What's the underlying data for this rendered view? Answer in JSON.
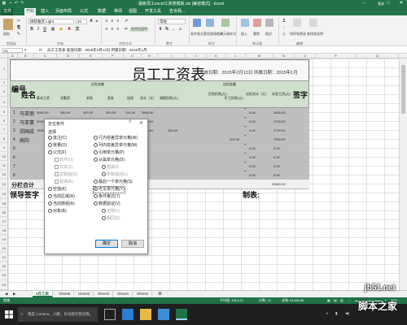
{
  "window": {
    "title": "最新员工excel工资表模板.xls [兼容模式] - Excel",
    "username": "登录"
  },
  "tabs": [
    "文件",
    "开始",
    "插入",
    "页面布局",
    "公式",
    "数据",
    "审阅",
    "视图",
    "开发工具",
    "告诉我..."
  ],
  "active_tab": "开始",
  "ribbon": {
    "paste_label": "粘贴",
    "clipboard_group": "剪贴板",
    "font_name": "微软雅黑 Light",
    "font_size": "20",
    "font_group": "字体",
    "align_group": "对齐方式",
    "number_format": "常规",
    "number_group": "数字",
    "style_items": [
      "条件格式",
      "套用表格格式",
      "单元格样式"
    ],
    "styles_group": "样式",
    "cells_items": [
      "插入",
      "删除",
      "格式"
    ],
    "cells_group": "单元格",
    "edit_items": [
      "排序和筛选",
      "查找和选择"
    ],
    "edit_group": "编辑",
    "cell_styles": [
      "常规",
      "差",
      "好",
      "适中"
    ],
    "merge_label": "合并后居中"
  },
  "formula_bar": {
    "name_box": "A1",
    "fx": "fx",
    "value": "员工工资表 发放日期：2015年2月12日 所属日期：2015年1月"
  },
  "columns": [
    "A",
    "B",
    "C",
    "D",
    "E",
    "F",
    "G",
    "H",
    "I",
    "J",
    "K",
    "L",
    "M",
    "N",
    "O",
    "P",
    "Q"
  ],
  "rows": [
    "1",
    "2",
    "3",
    "4",
    "5",
    "6",
    "7",
    "8",
    "9",
    "10",
    "11",
    "12",
    "13",
    "14",
    "15",
    "16",
    "17",
    "18",
    "19",
    "20",
    "21",
    "22",
    "23",
    "24",
    "25",
    "26"
  ],
  "sheet": {
    "title": "员工工资表",
    "subtitle": "发放日期：2015年2月12日  所属日期：2015年1月",
    "headers": {
      "no": "编号",
      "name": "姓名",
      "should_pay": "应发金额",
      "deduct": "应扣金额",
      "basic": "基本工资",
      "attend": "全勤奖",
      "subsidy": "补贴",
      "bonus": "奖金",
      "overtime": "加班",
      "total": "合计（元）",
      "leave": "请假扣款(元)",
      "late": "迟到扣款(元)",
      "absent": "旷工扣款(元)",
      "deduct_total": "应扣合计（元）",
      "real_pay": "实发工资(元)",
      "sign": "签字"
    },
    "employees": [
      {
        "no": "1",
        "name": "马亚丽",
        "basic": "3000.00",
        "attend": "150.00",
        "subsidy": "300.00",
        "bonus": "300.00",
        "overtime": "100.00",
        "total": "3850.00",
        "leave": "",
        "deduct_total": "0.00",
        "real": "3850.00"
      },
      {
        "no": "2",
        "name": "马亚寰",
        "basic": "2000.00",
        "attend": "150.00",
        "subsidy": "300.00",
        "bonus": "200.00",
        "overtime": "50.00",
        "total": "2700.00",
        "leave": "",
        "deduct_total": "0.00",
        "real": "2700.00"
      },
      {
        "no": "3",
        "name": "郑国成",
        "basic": "2500.00",
        "attend": "150.00",
        "subsidy": "300.00",
        "bonus": "100.00",
        "overtime": "",
        "total": "3050.00",
        "leave": "330.00",
        "deduct_total": "0.00",
        "real": "2720.00"
      },
      {
        "no": "4",
        "name": "高阳",
        "basic": "",
        "attend": "",
        "subsidy": "",
        "bonus": "",
        "overtime": "",
        "total": "",
        "leave": "",
        "deduct_total": "200.00",
        "real": "7900.00"
      },
      {
        "no": "5",
        "name": "",
        "basic": "",
        "attend": "",
        "subsidy": "",
        "bonus": "",
        "overtime": "",
        "total": "",
        "leave": "",
        "deduct_total": "0.00",
        "real": "0.00"
      },
      {
        "no": "6",
        "name": "",
        "basic": "",
        "attend": "",
        "subsidy": "",
        "bonus": "",
        "overtime": "",
        "total": "",
        "leave": "",
        "deduct_total": "0.00",
        "real": "0.00"
      },
      {
        "no": "7",
        "name": "",
        "basic": "",
        "attend": "",
        "subsidy": "",
        "bonus": "",
        "overtime": "",
        "total": "",
        "leave": "",
        "deduct_total": "0.00",
        "real": "0.00"
      },
      {
        "no": "8",
        "name": "",
        "basic": "",
        "attend": "",
        "subsidy": "",
        "bonus": "",
        "overtime": "",
        "total": "",
        "leave": "",
        "deduct_total": "0.00",
        "real": "0.00"
      }
    ],
    "sum_label": "分栏合计",
    "sum_total": "20820.00",
    "footer_left": "领导签字",
    "footer_right": "制表:"
  },
  "dialog": {
    "title": "定位条件",
    "help": "?",
    "close": "✕",
    "group_label": "选择",
    "left_options": [
      {
        "label": "批注(C)",
        "type": "radio",
        "checked": false,
        "disabled": false
      },
      {
        "label": "常量(O)",
        "type": "radio",
        "checked": false,
        "disabled": false
      },
      {
        "label": "公式(F)",
        "type": "radio",
        "checked": false,
        "disabled": false
      },
      {
        "label": "数字(U)",
        "type": "check",
        "checked": false,
        "disabled": true
      },
      {
        "label": "文本(X)",
        "type": "check",
        "checked": false,
        "disabled": true
      },
      {
        "label": "逻辑值(G)",
        "type": "check",
        "checked": false,
        "disabled": true
      },
      {
        "label": "错误(E)",
        "type": "check",
        "checked": false,
        "disabled": true
      },
      {
        "label": "空值(K)",
        "type": "radio",
        "checked": false,
        "disabled": false
      },
      {
        "label": "当前区域(R)",
        "type": "radio",
        "checked": false,
        "disabled": false
      },
      {
        "label": "当前数组(A)",
        "type": "radio",
        "checked": false,
        "disabled": false
      },
      {
        "label": "对象(B)",
        "type": "radio",
        "checked": false,
        "disabled": false
      }
    ],
    "right_options": [
      {
        "label": "行内容差异单元格(W)",
        "type": "radio",
        "checked": false,
        "disabled": false
      },
      {
        "label": "列内容差异单元格(M)",
        "type": "radio",
        "checked": false,
        "disabled": false
      },
      {
        "label": "引用单元格(P)",
        "type": "radio",
        "checked": false,
        "disabled": false
      },
      {
        "label": "从属单元格(D)",
        "type": "radio",
        "checked": false,
        "disabled": false
      },
      {
        "label": "直属(I)",
        "type": "radio",
        "checked": false,
        "disabled": true
      },
      {
        "label": "所有级别(L)",
        "type": "radio",
        "checked": false,
        "disabled": true
      },
      {
        "label": "最后一个单元格(S)",
        "type": "radio",
        "checked": false,
        "disabled": false
      },
      {
        "label": "可见单元格(Y)",
        "type": "radio",
        "checked": true,
        "disabled": false
      },
      {
        "label": "条件格式(T)",
        "type": "radio",
        "checked": false,
        "disabled": false
      },
      {
        "label": "数据验证(V)",
        "type": "radio",
        "checked": false,
        "disabled": false
      },
      {
        "label": "全部(L)",
        "type": "radio",
        "checked": false,
        "disabled": true
      },
      {
        "label": "相同(E)",
        "type": "radio",
        "checked": false,
        "disabled": true
      }
    ],
    "ok": "确定",
    "cancel": "取消"
  },
  "sheet_tabs": [
    "5月工资",
    "Sheet5",
    "Sheet3",
    "Sheet4",
    "Sheet1",
    "Sheet2"
  ],
  "active_sheet": "5月工资",
  "status": {
    "mode": "就绪",
    "avg": "平均值: 1513.22",
    "count": "计数: 72",
    "sum": "求和: 51449.56",
    "zoom": "88%"
  },
  "taskbar": {
    "search_placeholder": "我是 Cortana，小娜。有问题尽管问我。"
  },
  "watermark": {
    "site": "jb51.net",
    "brand": "脚本之家"
  },
  "colors": {
    "excel_green": "#217346",
    "header_band": "#cfe0cc",
    "selection": "#bfbfbf"
  }
}
